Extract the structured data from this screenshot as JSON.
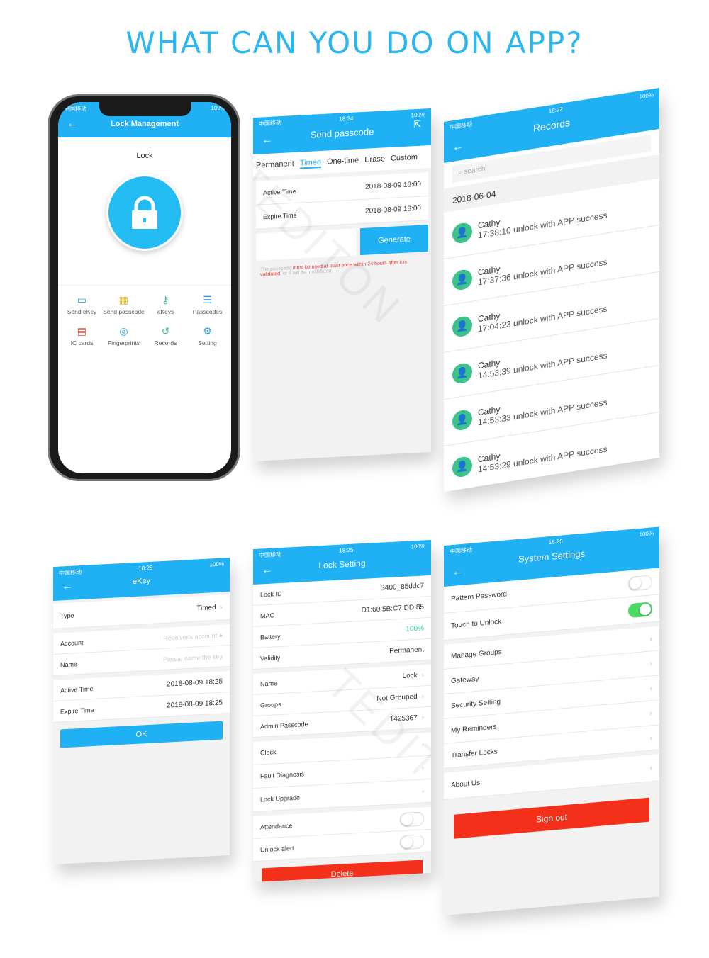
{
  "headline": "WHAT CAN YOU DO ON APP?",
  "watermark": "TEDITON",
  "colors": {
    "accent": "#1fb1f4",
    "danger": "#f5301a",
    "success": "#4cd964"
  },
  "status": {
    "carrier": "中国移动",
    "battery": "100%",
    "time_a": "18:24",
    "time_b": "18:22",
    "time_c": "18:25"
  },
  "lock_mgmt": {
    "title": "Lock Management",
    "lock_name": "Lock",
    "icon": "padlock-icon",
    "items": [
      {
        "label": "Send eKey",
        "icon": "ekey-card-icon",
        "color": "#2aa7e8"
      },
      {
        "label": "Send passcode",
        "icon": "calculator-icon",
        "color": "#f2b51f"
      },
      {
        "label": "eKeys",
        "icon": "keys-icon",
        "color": "#3cc28a"
      },
      {
        "label": "Passcodes",
        "icon": "list-icon",
        "color": "#2aa7e8"
      },
      {
        "label": "IC cards",
        "icon": "card-icon",
        "color": "#e8503a"
      },
      {
        "label": "Fingerprints",
        "icon": "fingerprint-icon",
        "color": "#2aa7e8"
      },
      {
        "label": "Records",
        "icon": "history-icon",
        "color": "#3cc28a"
      },
      {
        "label": "Setting",
        "icon": "gear-icon",
        "color": "#2aa7e8"
      }
    ]
  },
  "send_passcode": {
    "title": "Send passcode",
    "tabs": [
      "Permanent",
      "Timed",
      "One-time",
      "Erase",
      "Custom"
    ],
    "active_tab": "Timed",
    "rows": [
      {
        "label": "Active Time",
        "value": "2018-08-09 18:00"
      },
      {
        "label": "Expire Time",
        "value": "2018-08-09 18:00"
      }
    ],
    "generate": "Generate",
    "note_a": "The passcode ",
    "note_b": "must be used at least once within 24 hours after it is validated",
    ", or it will be invalidated.": "",
    "note_c": ", or it will be invalidated."
  },
  "records": {
    "title": "Records",
    "search_placeholder": "search",
    "date": "2018-06-04",
    "items": [
      {
        "name": "Cathy",
        "text": "17:38:10 unlock with APP success"
      },
      {
        "name": "Cathy",
        "text": "17:37:36 unlock with APP success"
      },
      {
        "name": "Cathy",
        "text": "17:04:23 unlock with APP success"
      },
      {
        "name": "Cathy",
        "text": "14:53:39 unlock with APP success"
      },
      {
        "name": "Cathy",
        "text": "14:53:33 unlock with APP success"
      },
      {
        "name": "Cathy",
        "text": "14:53:29 unlock with APP success"
      },
      {
        "name": "Cathy",
        "text": ""
      }
    ]
  },
  "ekey": {
    "title": "eKey",
    "type_label": "Type",
    "type_value": "Timed",
    "account_label": "Account",
    "account_placeholder": "Receiver's account",
    "name_label": "Name",
    "name_placeholder": "Please name the key",
    "active_label": "Active Time",
    "active_value": "2018-08-09 18:25",
    "expire_label": "Expire Time",
    "expire_value": "2018-08-09 18:25",
    "ok": "OK"
  },
  "lock_setting": {
    "title": "Lock Setting",
    "info": [
      {
        "label": "Lock ID",
        "value": "S400_85ddc7"
      },
      {
        "label": "MAC",
        "value": "D1:60:5B:C7:DD:85"
      },
      {
        "label": "Battery",
        "value": "100%"
      },
      {
        "label": "Validity",
        "value": "Permanent"
      }
    ],
    "editable": [
      {
        "label": "Name",
        "value": "Lock"
      },
      {
        "label": "Groups",
        "value": "Not Grouped"
      },
      {
        "label": "Admin Passcode",
        "value": "1425367"
      }
    ],
    "links": [
      {
        "label": "Clock"
      },
      {
        "label": "Fault Diagnosis"
      },
      {
        "label": "Lock Upgrade"
      }
    ],
    "toggles": [
      {
        "label": "Attendance",
        "on": false
      },
      {
        "label": "Unlock alert",
        "on": false
      }
    ],
    "delete": "Delete"
  },
  "system_settings": {
    "title": "System Settings",
    "toggles": [
      {
        "label": "Pattern Password",
        "on": false
      },
      {
        "label": "Touch to Unlock",
        "on": true
      }
    ],
    "links": [
      {
        "label": "Manage Groups"
      },
      {
        "label": "Gateway"
      },
      {
        "label": "Security Setting"
      },
      {
        "label": "My Reminders"
      },
      {
        "label": "Transfer Locks"
      }
    ],
    "about": "About Us",
    "sign_out": "Sign out"
  }
}
